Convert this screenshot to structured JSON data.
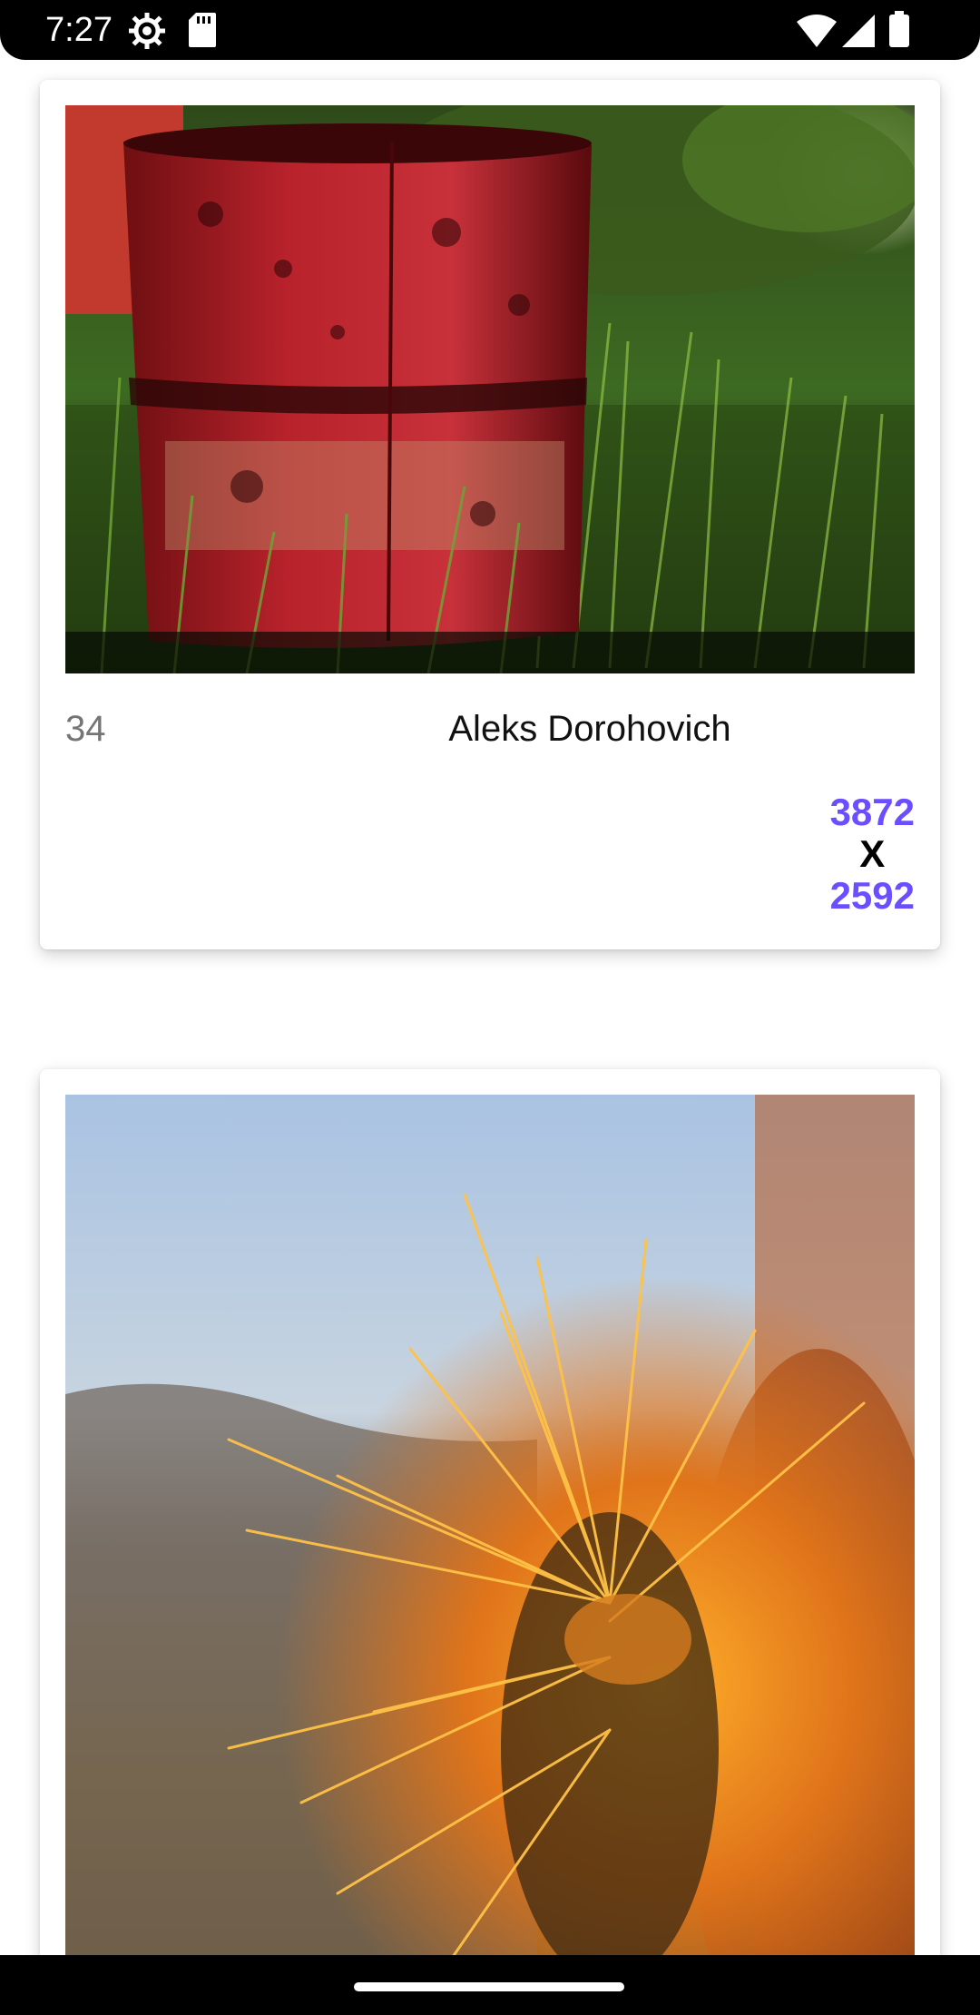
{
  "status_bar": {
    "time": "7:27",
    "icons": [
      "settings-gear-icon",
      "sd-card-icon",
      "wifi-icon",
      "cell-signal-icon",
      "battery-icon"
    ]
  },
  "cards": [
    {
      "id": "34",
      "author": "Aleks Dorohovich",
      "width": "3872",
      "separator": "X",
      "height": "2592",
      "photo": "rusty-red-barrel-in-grass-photo"
    },
    {
      "photo": "orange-cactus-spines-closeup-photo"
    }
  ],
  "colors": {
    "accent": "#6b4eff",
    "id_text": "#757575",
    "author_text": "#111111"
  }
}
